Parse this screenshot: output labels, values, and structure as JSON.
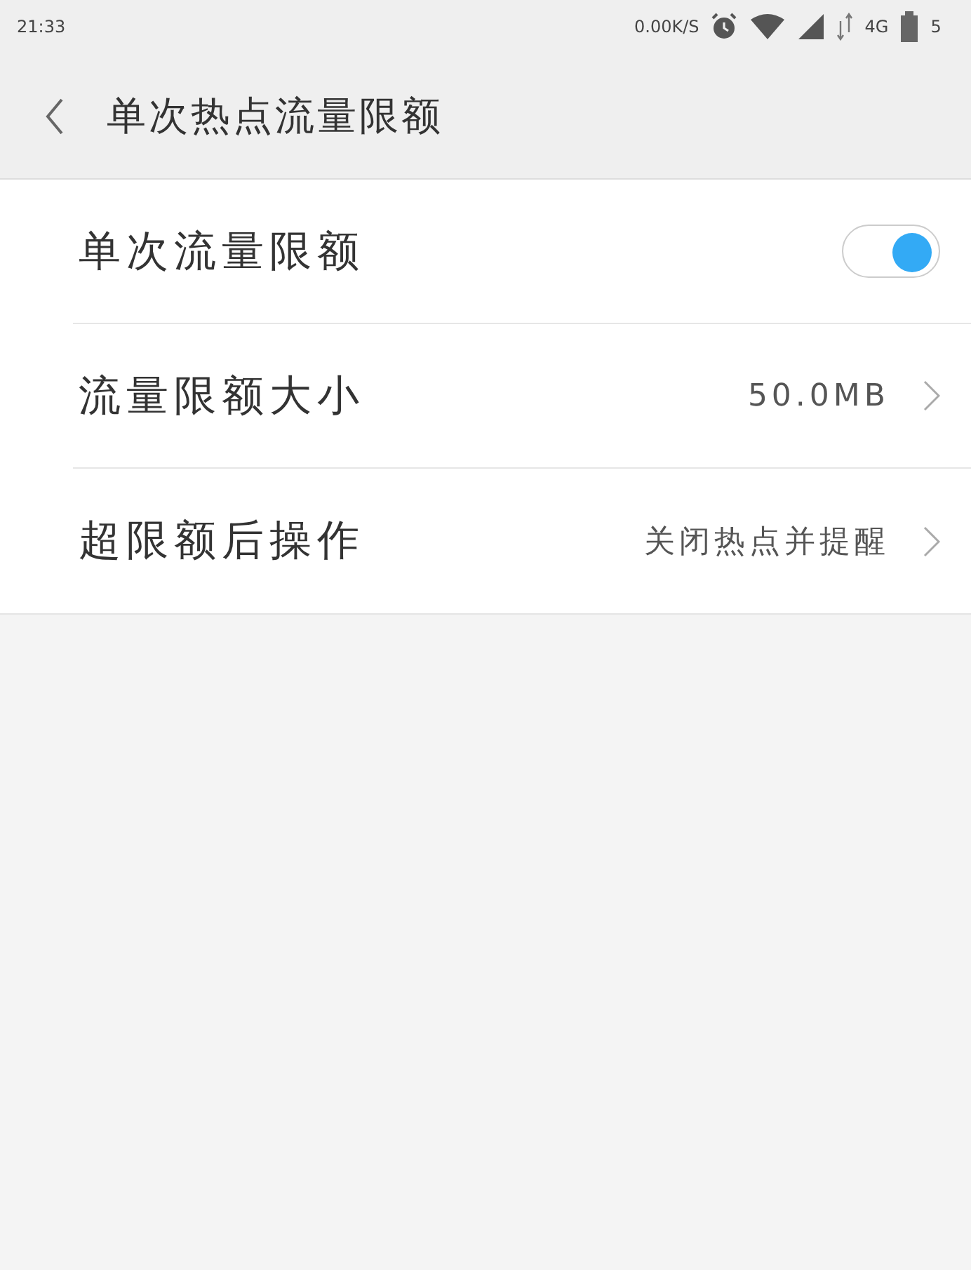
{
  "status_bar": {
    "time": "21:33",
    "speed": "0.00K/S",
    "network": "4G",
    "battery": "5"
  },
  "header": {
    "title": "单次热点流量限额"
  },
  "settings": [
    {
      "kind": "toggle",
      "label": "单次流量限额",
      "on": true
    },
    {
      "kind": "value",
      "label": "流量限额大小",
      "value": "50.0MB"
    },
    {
      "kind": "value",
      "label": "超限额后操作",
      "value": "关闭热点并提醒"
    }
  ]
}
